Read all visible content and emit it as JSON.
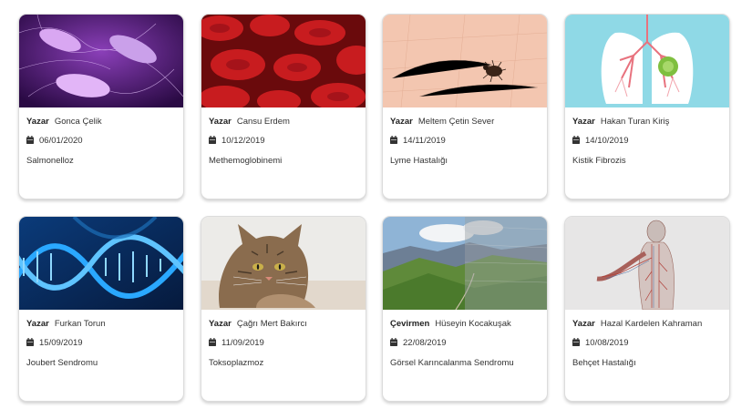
{
  "cards": [
    {
      "role": "Yazar",
      "author": "Gonca Çelik",
      "date": "06/01/2020",
      "title": "Salmonelloz",
      "image": "purple-bacteria-image"
    },
    {
      "role": "Yazar",
      "author": "Cansu Erdem",
      "date": "10/12/2019",
      "title": "Methemoglobinemi",
      "image": "red-blood-cells-image"
    },
    {
      "role": "Yazar",
      "author": "Meltem Çetin Sever",
      "date": "14/11/2019",
      "title": "Lyme Hastalığı",
      "image": "tick-on-skin-image"
    },
    {
      "role": "Yazar",
      "author": "Hakan Turan Kiriş",
      "date": "14/10/2019",
      "title": "Kistik Fibrozis",
      "image": "lungs-illustration-image"
    },
    {
      "role": "Yazar",
      "author": "Furkan Torun",
      "date": "15/09/2019",
      "title": "Joubert Sendromu",
      "image": "blue-dna-helix-image"
    },
    {
      "role": "Yazar",
      "author": "Çağrı Mert Bakırcı",
      "date": "11/09/2019",
      "title": "Toksoplazmoz",
      "image": "tabby-cat-image"
    },
    {
      "role": "Çevirmen",
      "author": "Hüseyin Kocakuşak",
      "date": "22/08/2019",
      "title": "Görsel Karıncalanma Sendromu",
      "image": "mountain-landscape-image"
    },
    {
      "role": "Yazar",
      "author": "Hazal Kardelen Kahraman",
      "date": "10/08/2019",
      "title": "Behçet Hastalığı",
      "image": "anatomy-vessels-image"
    }
  ]
}
